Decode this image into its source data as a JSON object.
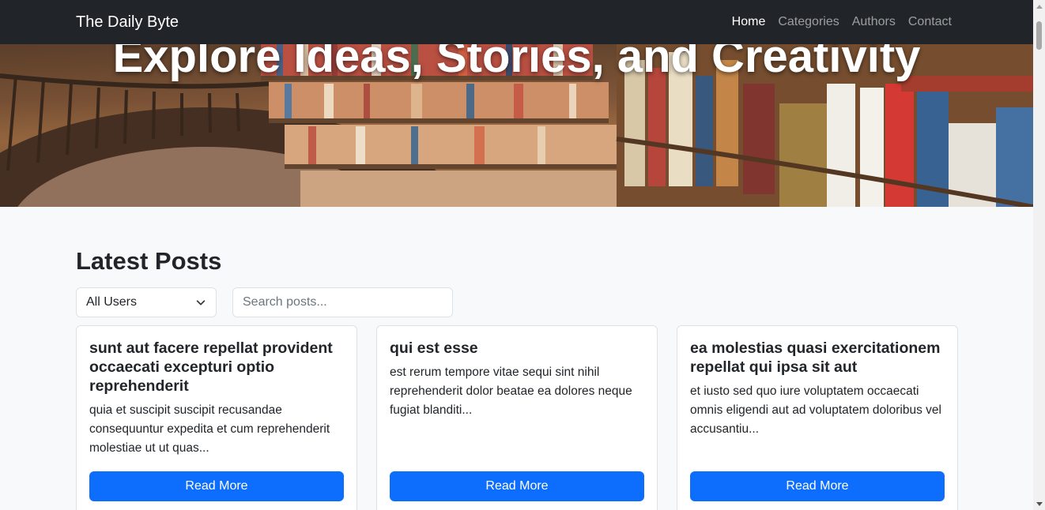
{
  "navbar": {
    "brand": "The Daily Byte",
    "links": [
      {
        "label": "Home",
        "active": true
      },
      {
        "label": "Categories",
        "active": false
      },
      {
        "label": "Authors",
        "active": false
      },
      {
        "label": "Contact",
        "active": false
      }
    ]
  },
  "hero": {
    "title": "Explore Ideas, Stories, and Creativity",
    "image_subject": "library-bookshelves"
  },
  "main": {
    "heading": "Latest Posts",
    "filter": {
      "selected": "All Users"
    },
    "search": {
      "placeholder": "Search posts...",
      "value": ""
    },
    "posts": [
      {
        "title": "sunt aut facere repellat provident occaecati excepturi optio reprehenderit",
        "excerpt": "quia et suscipit suscipit recusandae consequuntur expedita et cum reprehenderit molestiae ut ut quas...",
        "button": "Read More"
      },
      {
        "title": "qui est esse",
        "excerpt": "est rerum tempore vitae sequi sint nihil reprehenderit dolor beatae ea dolores neque fugiat blanditi...",
        "button": "Read More"
      },
      {
        "title": "ea molestias quasi exercitationem repellat qui ipsa sit aut",
        "excerpt": "et iusto sed quo iure voluptatem occaecati omnis eligendi aut ad voluptatem doloribus vel accusantiu...",
        "button": "Read More"
      }
    ]
  },
  "colors": {
    "navbar_bg": "#212529",
    "primary": "#0d6efd",
    "page_bg": "#f8f9fa"
  },
  "icons": {
    "select_caret": "chevron-down-icon",
    "scroll_up": "scroll-up-arrow-icon",
    "scroll_down": "scroll-down-arrow-icon"
  }
}
